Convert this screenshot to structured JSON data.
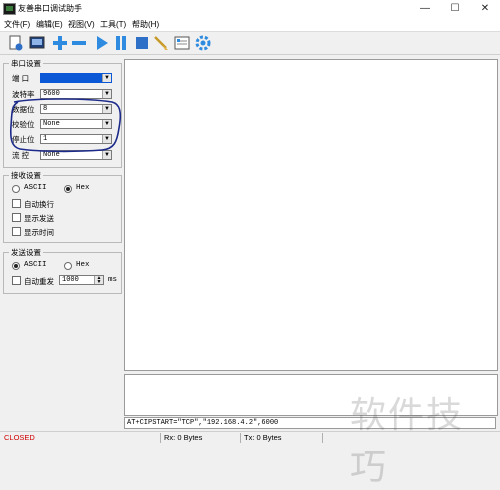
{
  "window": {
    "title": "友善串口调试助手",
    "controls": {
      "minimize": "—",
      "maximize": "☐",
      "close": "✕"
    }
  },
  "menu": [
    "文件(F)",
    "编辑(E)",
    "视图(V)",
    "工具(T)",
    "帮助(H)"
  ],
  "toolbar_icons": [
    "new-session-icon",
    "terminal-icon",
    "add-icon",
    "remove-icon",
    "play-icon",
    "pause-icon",
    "stop-icon",
    "clear-icon",
    "options-icon",
    "settings-gear-icon"
  ],
  "serial_settings": {
    "title": "串口设置",
    "port": {
      "label": "端 口",
      "value": ""
    },
    "baud": {
      "label": "波特率",
      "value": "9600"
    },
    "databits": {
      "label": "数据位",
      "value": "8"
    },
    "parity": {
      "label": "校验位",
      "value": "None"
    },
    "stopbits": {
      "label": "停止位",
      "value": "1"
    },
    "flow": {
      "label": "流 控",
      "value": "None"
    }
  },
  "recv_settings": {
    "title": "接收设置",
    "ascii": "ASCII",
    "hex": "Hex",
    "selected": "Hex",
    "auto_newline": "自动换行",
    "show_send": "显示发送",
    "show_time": "显示时间"
  },
  "send_settings": {
    "title": "发送设置",
    "ascii": "ASCII",
    "hex": "Hex",
    "selected": "ASCII",
    "auto_resend": "自动重发",
    "interval": "1000",
    "unit": "ms"
  },
  "command_text": "AT+CIPSTART=\"TCP\",\"192.168.4.2\",6000",
  "status": {
    "state": "CLOSED",
    "rx": "Rx: 0 Bytes",
    "tx": "Tx: 0 Bytes"
  },
  "watermark": "软件技巧",
  "colors": {
    "port_selected": "#0a58d6",
    "status_closed": "#d00000",
    "annotation_ink": "#1c2a8a"
  }
}
